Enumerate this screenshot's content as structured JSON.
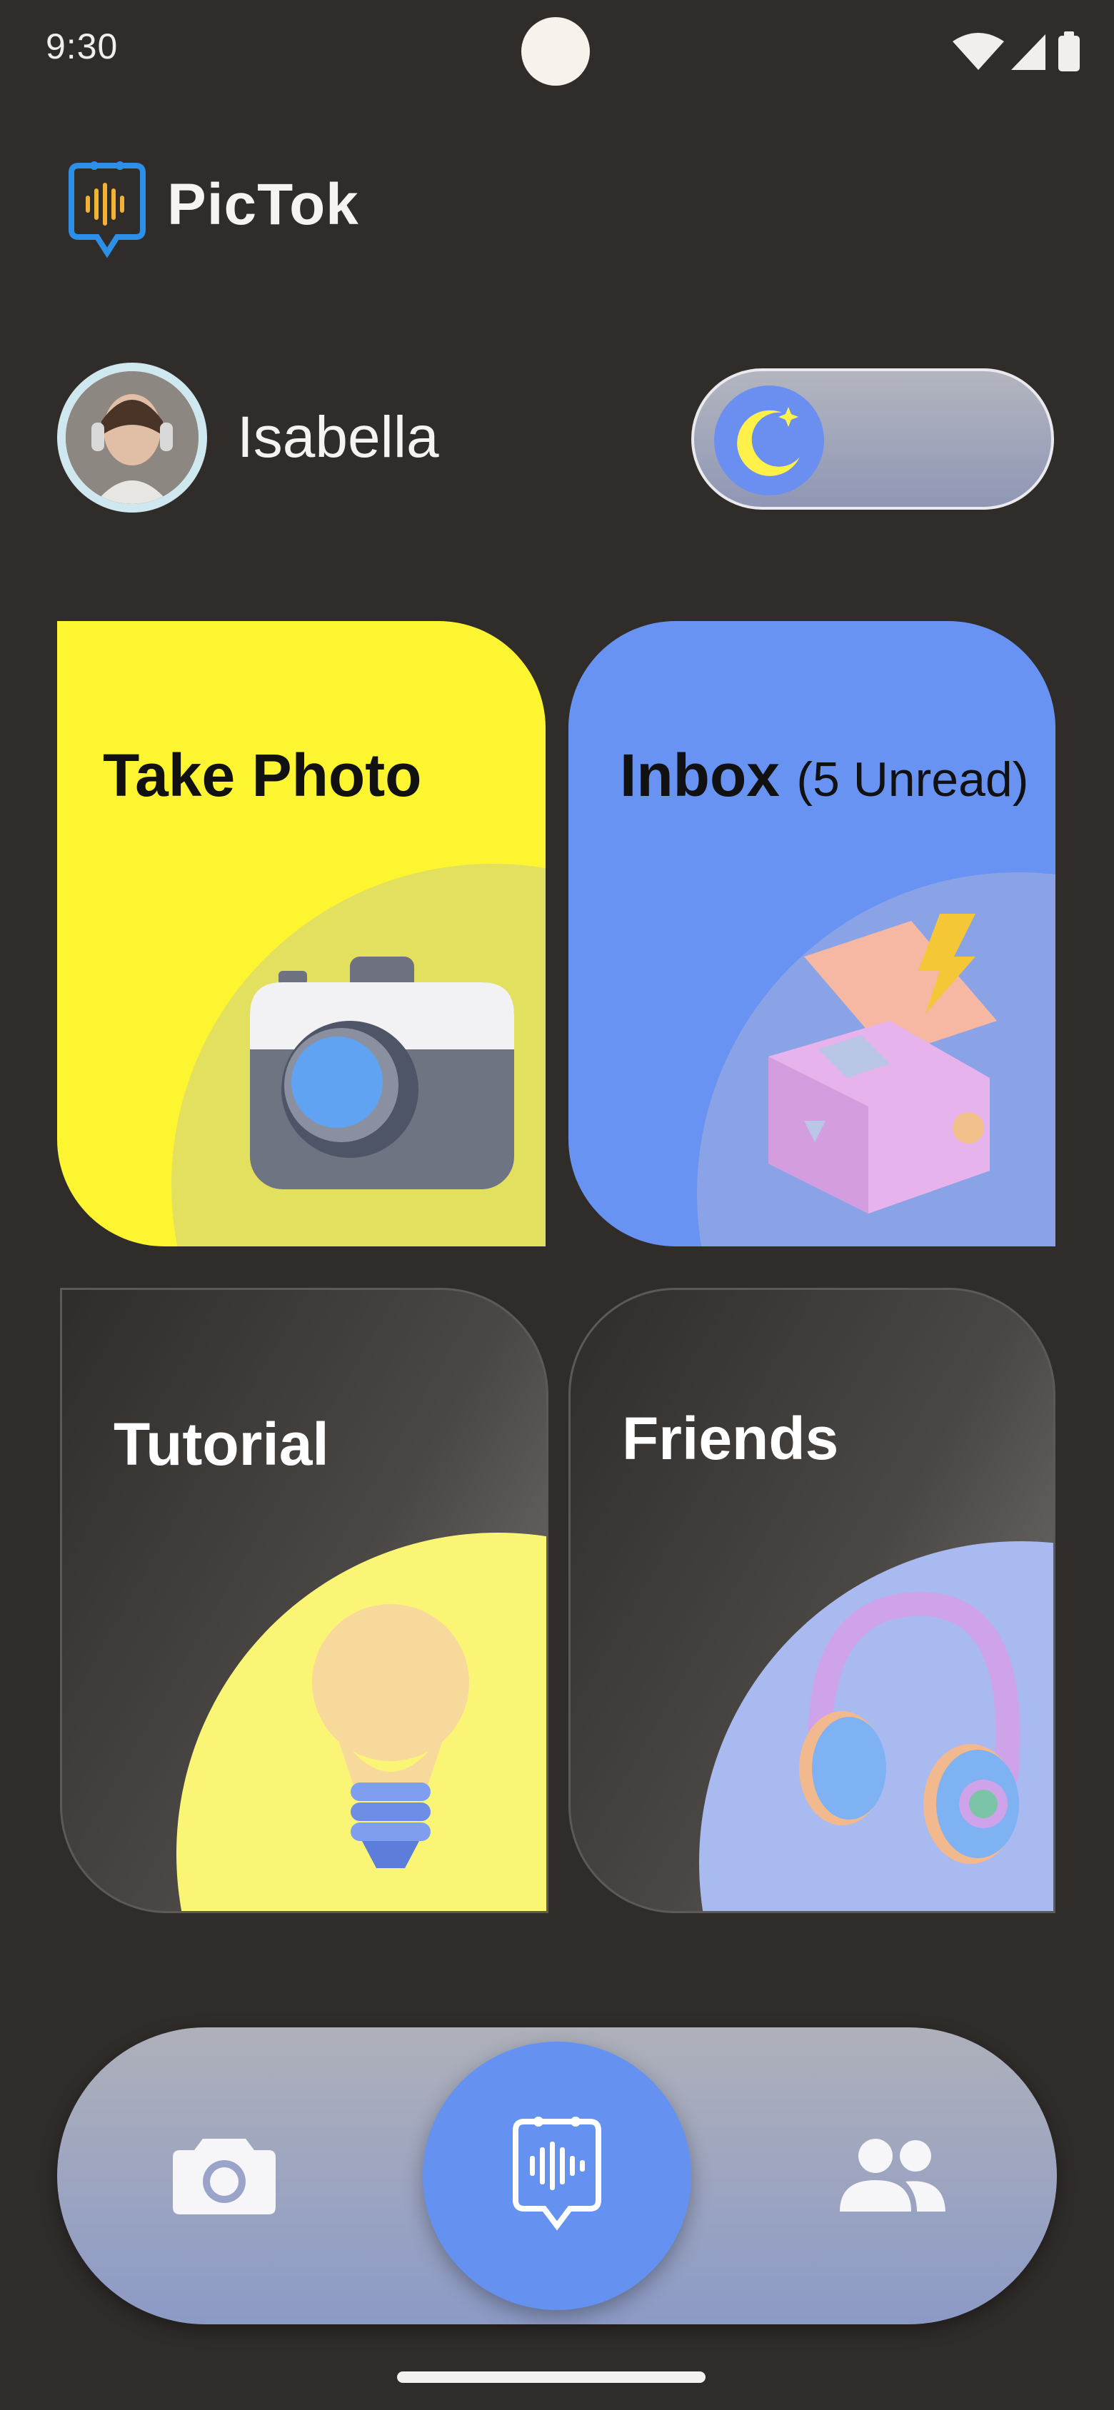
{
  "status_bar": {
    "time": "9:30"
  },
  "header": {
    "app_name": "PicTok",
    "logo_icon": "pictok-logo-icon"
  },
  "user": {
    "name": "Isabella",
    "avatar": "user-avatar-photo"
  },
  "theme_toggle": {
    "icon": "moon-icon",
    "state": "dark"
  },
  "cards": {
    "take_photo": {
      "title": "Take Photo",
      "icon": "camera-icon"
    },
    "inbox": {
      "title": "Inbox",
      "subtitle": "(5 Unread)",
      "icon": "gift-box-icon"
    },
    "tutorial": {
      "title": "Tutorial",
      "icon": "lightbulb-icon"
    },
    "friends": {
      "title": "Friends",
      "icon": "headphones-icon"
    }
  },
  "bottom_nav": {
    "items": [
      {
        "icon": "camera-icon"
      },
      {
        "icon": "pictok-logo-icon",
        "active": true
      },
      {
        "icon": "group-icon"
      }
    ]
  },
  "colors": {
    "background": "#2f2c2a",
    "accent_blue": "#6592f0",
    "accent_yellow": "#fdf52f"
  }
}
